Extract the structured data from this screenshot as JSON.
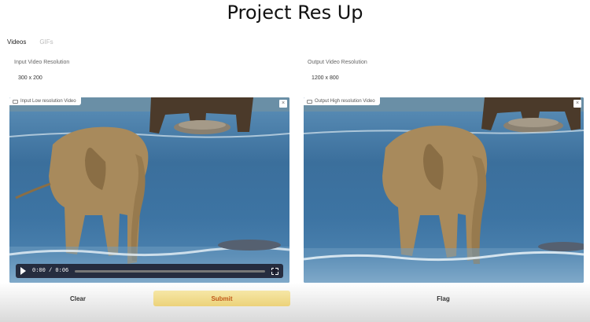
{
  "app": {
    "title": "Project Res Up"
  },
  "tabs": [
    {
      "label": "Videos",
      "active": true
    },
    {
      "label": "GIFs",
      "active": false
    }
  ],
  "input_panel": {
    "resolution_label": "Input Video Resolution",
    "resolution_value": "300 x 200",
    "video_badge": "Input Low resolution Video",
    "player": {
      "current_time": "0:00",
      "separator": "/",
      "duration": "0:06"
    }
  },
  "output_panel": {
    "resolution_label": "Output Video Resolution",
    "resolution_value": "1200 x 800",
    "video_badge": "Output High resolution Video"
  },
  "buttons": {
    "clear": "Clear",
    "submit": "Submit",
    "flag": "Flag"
  },
  "colors": {
    "submit_bg": "#ecd27a",
    "submit_text": "#c0581a",
    "water": "#3d74a3"
  },
  "icons": {
    "close": "×"
  }
}
